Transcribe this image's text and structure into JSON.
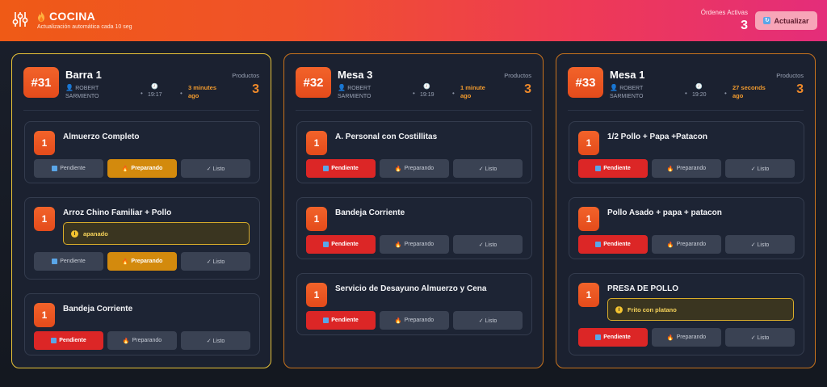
{
  "header": {
    "title": "COCINA",
    "subtitle": "Actualización automática cada 10 seg",
    "active_label": "Órdenes Activas",
    "active_count": "3",
    "refresh_label": "Actualizar",
    "colors": {
      "gradient_start": "#ef5a16",
      "gradient_end": "#e42d7a"
    }
  },
  "labels": {
    "products": "Productos",
    "pending": "Pendiente",
    "preparing": "Preparando",
    "ready": "✓ Listo"
  },
  "orders": [
    {
      "number": "#31",
      "table": "Barra 1",
      "waiter_first": "ROBERT",
      "waiter_last": "SARMIENTO",
      "time": "19:17",
      "ago_line1": "3 minutes",
      "ago_line2": "ago",
      "product_count": "3",
      "items": [
        {
          "qty": "1",
          "name": "Almuerzo Completo",
          "note": null,
          "status": "preparing"
        },
        {
          "qty": "1",
          "name": "Arroz Chino Familiar + Pollo",
          "note": "apanado",
          "status": "preparing"
        },
        {
          "qty": "1",
          "name": "Bandeja Corriente",
          "note": null,
          "status": "pending"
        }
      ]
    },
    {
      "number": "#32",
      "table": "Mesa 3",
      "waiter_first": "ROBERT",
      "waiter_last": "SARMIENTO",
      "time": "19:19",
      "ago_line1": "1 minute",
      "ago_line2": "ago",
      "product_count": "3",
      "items": [
        {
          "qty": "1",
          "name": "A. Personal con Costillitas",
          "note": null,
          "status": "pending"
        },
        {
          "qty": "1",
          "name": "Bandeja Corriente",
          "note": null,
          "status": "pending"
        },
        {
          "qty": "1",
          "name": "Servicio de Desayuno Almuerzo y Cena",
          "note": null,
          "status": "pending"
        }
      ]
    },
    {
      "number": "#33",
      "table": "Mesa 1",
      "waiter_first": "ROBERT",
      "waiter_last": "SARMIENTO",
      "time": "19:20",
      "ago_line1": "27 seconds",
      "ago_line2": "ago",
      "product_count": "3",
      "items": [
        {
          "qty": "1",
          "name": "1/2 Pollo + Papa +Patacon",
          "note": null,
          "status": "pending"
        },
        {
          "qty": "1",
          "name": "Pollo Asado + papa + patacon",
          "note": null,
          "status": "pending"
        },
        {
          "qty": "1",
          "name": "PRESA DE POLLO",
          "note": "Frito con platano",
          "status": "pending"
        }
      ]
    }
  ]
}
